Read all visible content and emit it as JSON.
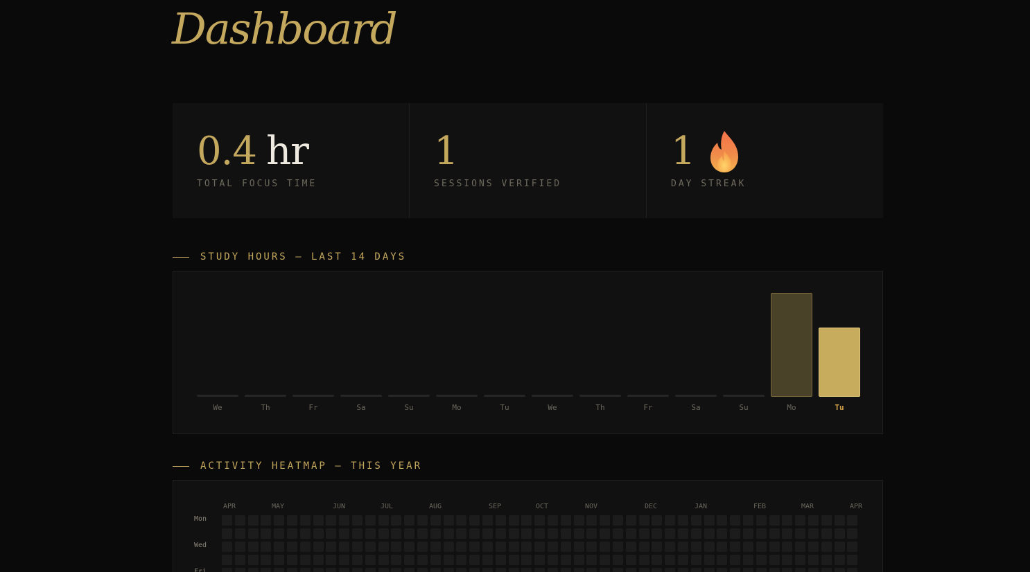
{
  "header": {
    "title": "Dashboard"
  },
  "stats": [
    {
      "value": "0.4",
      "unit": "hr",
      "label": "TOTAL FOCUS TIME"
    },
    {
      "value": "1",
      "unit": "",
      "label": "SESSIONS VERIFIED"
    },
    {
      "value": "1",
      "unit": "",
      "label": "DAY STREAK",
      "icon": "flame-icon"
    }
  ],
  "study_hours": {
    "heading": "STUDY HOURS — LAST 14 DAYS",
    "chart_data": {
      "type": "bar",
      "categories": [
        "We",
        "Th",
        "Fr",
        "Sa",
        "Su",
        "Mo",
        "Tu",
        "We",
        "Th",
        "Fr",
        "Sa",
        "Su",
        "Mo",
        "Tu"
      ],
      "values": [
        0,
        0,
        0,
        0,
        0,
        0,
        0,
        0,
        0,
        0,
        0,
        0,
        0.24,
        0.16
      ],
      "highlight_index": 13,
      "ylim": [
        0,
        0.24
      ]
    }
  },
  "heatmap": {
    "heading": "ACTIVITY HEATMAP — THIS YEAR",
    "months": [
      "APR",
      "MAY",
      "JUN",
      "JUL",
      "AUG",
      "SEP",
      "OCT",
      "NOV",
      "DEC",
      "JAN",
      "FEB",
      "MAR",
      "APR"
    ],
    "day_labels": [
      "Mon",
      "Wed",
      "Fri"
    ]
  },
  "colors": {
    "accent": "#c4a85e",
    "background": "#0a0a0a",
    "panel": "#111111",
    "today_label": "#d4a24a"
  }
}
